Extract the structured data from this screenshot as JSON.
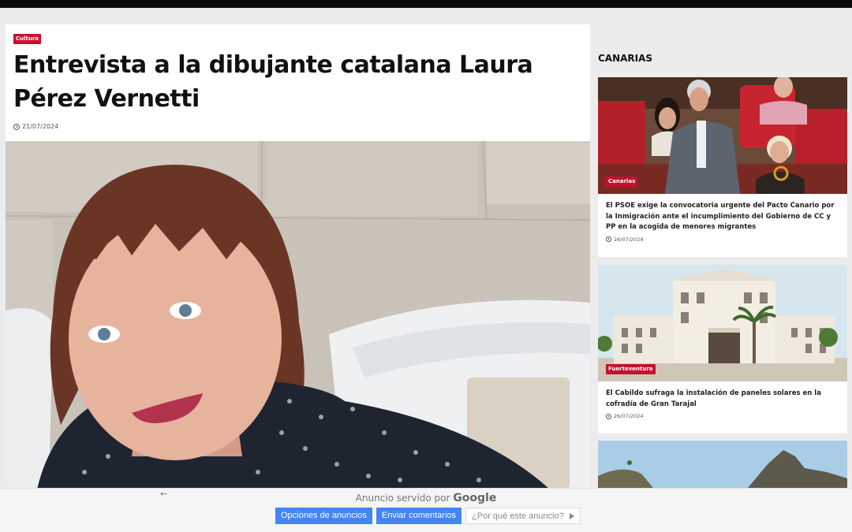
{
  "article": {
    "category": "Cultura",
    "title": "Entrevista a la dibujante catalana Laura Pérez Vernetti",
    "date": "21/07/2024"
  },
  "sidebar": {
    "heading": "CANARIAS",
    "cards": [
      {
        "tag": "Canarias",
        "headline": "El PSOE exige la convocatoria urgente del Pacto Canario por la Inmigración ante el incumplimiento del Gobierno de CC y PP en la acogida de menores migrantes",
        "date": "26/07/2024"
      },
      {
        "tag": "Fuerteventura",
        "headline": "El Cabildo sufraga la instalación de paneles solares en la cofradía de Gran Tarajal",
        "date": "26/07/2024"
      }
    ]
  },
  "adbar": {
    "back_icon": "←",
    "served_text": "Anuncio servido por",
    "served_brand": "Google",
    "options_label": "Opciones de anuncios",
    "feedback_label": "Enviar comentarios",
    "why_label": "¿Por qué este anuncio?"
  }
}
